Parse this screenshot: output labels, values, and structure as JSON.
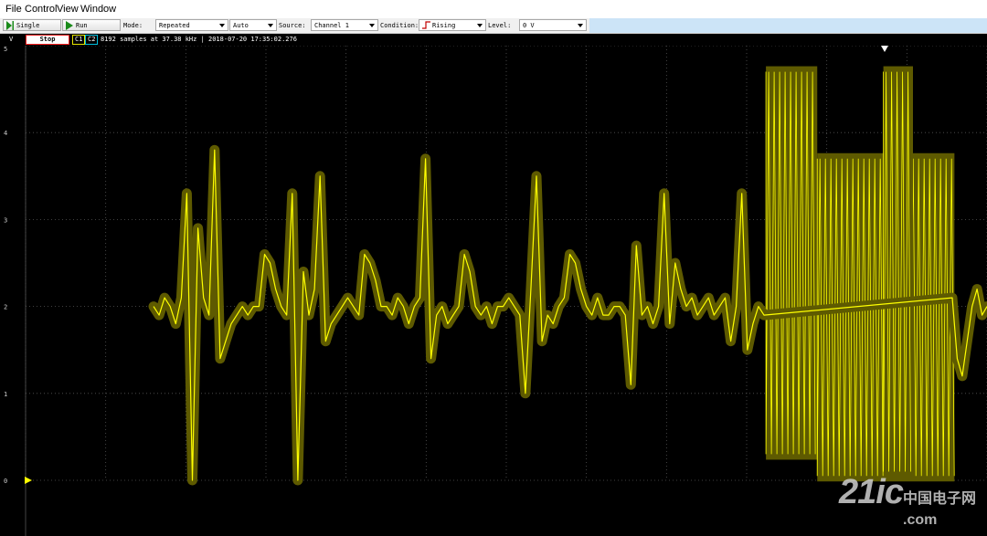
{
  "menu": [
    "File",
    "Control",
    "View",
    "Window"
  ],
  "toolbar": {
    "single_label": "Single",
    "run_label": "Run",
    "mode_label": "Mode:",
    "mode_value": "Repeated",
    "trigger_value": "Auto",
    "source_label": "Source:",
    "source_value": "Channel 1",
    "condition_label": "Condition:",
    "condition_value": "Rising",
    "level_label": "Level:",
    "level_value": "0 V"
  },
  "status": {
    "unit": "V",
    "stop_label": "Stop",
    "ch1": "C1",
    "ch2": "C2",
    "info": "8192 samples at 37.38 kHz | 2018-07-20 17:35:02.276"
  },
  "axis": {
    "ylim": [
      0,
      5
    ],
    "ticks": [
      "5",
      "4",
      "3",
      "2",
      "1",
      "0"
    ]
  },
  "colors": {
    "trace": "#ffff00",
    "envelope": "#5e5a00",
    "grid": "#555555",
    "background": "#000000"
  },
  "watermark": {
    "big": "21ic",
    "small": "中国电子网",
    "suffix": ".com"
  },
  "chart_data": {
    "type": "line",
    "ylim": [
      0,
      5
    ],
    "xlabel": "",
    "ylabel": "V",
    "grid": true,
    "series": [
      {
        "values": [
          2.0,
          1.9,
          2.1,
          2.0,
          1.8,
          2.1,
          3.3,
          0.0,
          2.9,
          2.1,
          1.9,
          3.8,
          1.4,
          1.6,
          1.8,
          1.9,
          2.0,
          1.9,
          2.0,
          2.0,
          2.6,
          2.5,
          2.2,
          2.0,
          1.9,
          3.3,
          0.0,
          2.4,
          1.9,
          2.2,
          3.5,
          1.6,
          1.8,
          1.9,
          2.0,
          2.1,
          2.0,
          1.9,
          2.6,
          2.5,
          2.3,
          2.0,
          2.0,
          1.9,
          2.1,
          2.0,
          1.8,
          2.0,
          2.1,
          3.7,
          1.4,
          1.9,
          2.0,
          1.8,
          1.9,
          2.0,
          2.6,
          2.4,
          2.0,
          1.9,
          2.0,
          1.8,
          2.0,
          2.0,
          2.1,
          2.0,
          1.9,
          1.0,
          2.2,
          3.5,
          1.6,
          1.9,
          1.8,
          2.0,
          2.1,
          2.6,
          2.5,
          2.2,
          2.0,
          1.9,
          2.1,
          1.9,
          1.9,
          2.0,
          2.0,
          1.9,
          1.1,
          2.7,
          1.9,
          2.0,
          1.8,
          2.0,
          3.3,
          1.8,
          2.5,
          2.2,
          2.0,
          2.1,
          1.9,
          2.0,
          2.1,
          1.9,
          2.0,
          2.1,
          1.6,
          2.0,
          3.3,
          1.5,
          1.8,
          2.0,
          1.9
        ]
      }
    ],
    "burst_regions": [
      {
        "x0": 0.776,
        "x1": 0.828,
        "high": 4.7,
        "low": 0.3
      },
      {
        "x0": 0.828,
        "x1": 0.967,
        "high": 3.7,
        "low": 0.05
      },
      {
        "x0": 0.895,
        "x1": 0.925,
        "high": 4.7,
        "low": 0.1
      }
    ]
  }
}
